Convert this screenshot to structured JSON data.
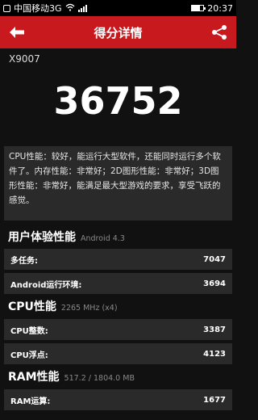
{
  "status_bar": {
    "carrier": "中国移动3G",
    "time": "20:37"
  },
  "header": {
    "title": "得分详情"
  },
  "device": "X9007",
  "score": "36752",
  "description": "CPU性能：较好，能运行大型软件，还能同时运行多个软件了。内存性能：非常好；2D图形性能：非常好；3D图形性能：非常好，能满足最大型游戏的要求，享受飞跃的感觉。",
  "sections": [
    {
      "title": "用户体验性能",
      "subtitle": "Android 4.3",
      "rows": [
        {
          "label": "多任务:",
          "value": "7047"
        },
        {
          "label": "Android运行环境:",
          "value": "3694"
        }
      ]
    },
    {
      "title": "CPU性能",
      "subtitle": "2265 MHz (x4)",
      "rows": [
        {
          "label": "CPU整数:",
          "value": "3387"
        },
        {
          "label": "CPU浮点:",
          "value": "4123"
        }
      ]
    },
    {
      "title": "RAM性能",
      "subtitle": "517.2 / 1804.0 MB",
      "rows": [
        {
          "label": "RAM运算:",
          "value": "1677"
        }
      ]
    }
  ],
  "colors": {
    "accent": "#c8191f",
    "background": "#111111",
    "panel": "#2a2a2a"
  }
}
